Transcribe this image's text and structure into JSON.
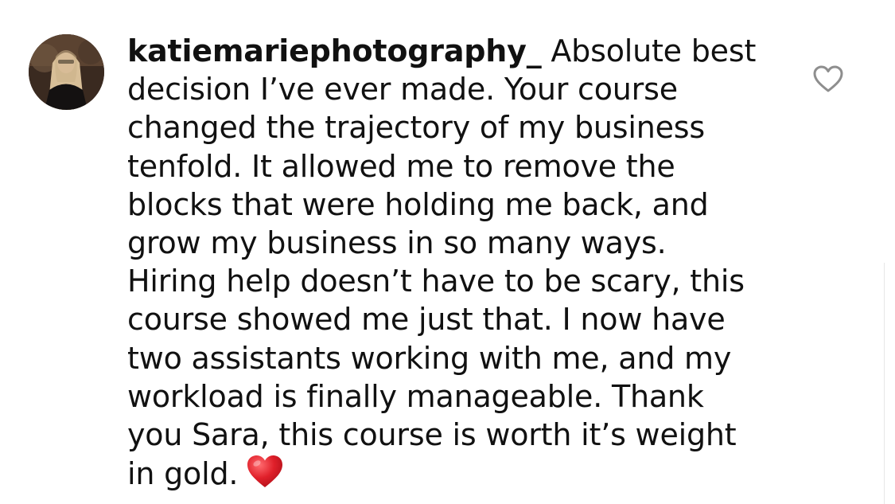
{
  "comment": {
    "username": "katiemariephotography_",
    "lines": [
      " Absolute best",
      "decision I’ve ever made. Your course",
      "changed the trajectory of my business",
      "tenfold. It allowed me to remove the",
      "blocks that were holding me back, and",
      "grow my business in so many ways.",
      "Hiring help doesn’t have to be scary, this",
      "course showed me just that. I now have",
      "two assistants working with me, and my",
      "workload is finally manageable. Thank",
      "you Sara, this course is worth it’s weight",
      "in gold."
    ],
    "trailing_emoji": "heart-emoji",
    "like_icon": "heart-outline-icon",
    "colors": {
      "text": "#111111",
      "like_icon_stroke": "#8e8e8e",
      "emoji_red": "#e0202a"
    }
  }
}
